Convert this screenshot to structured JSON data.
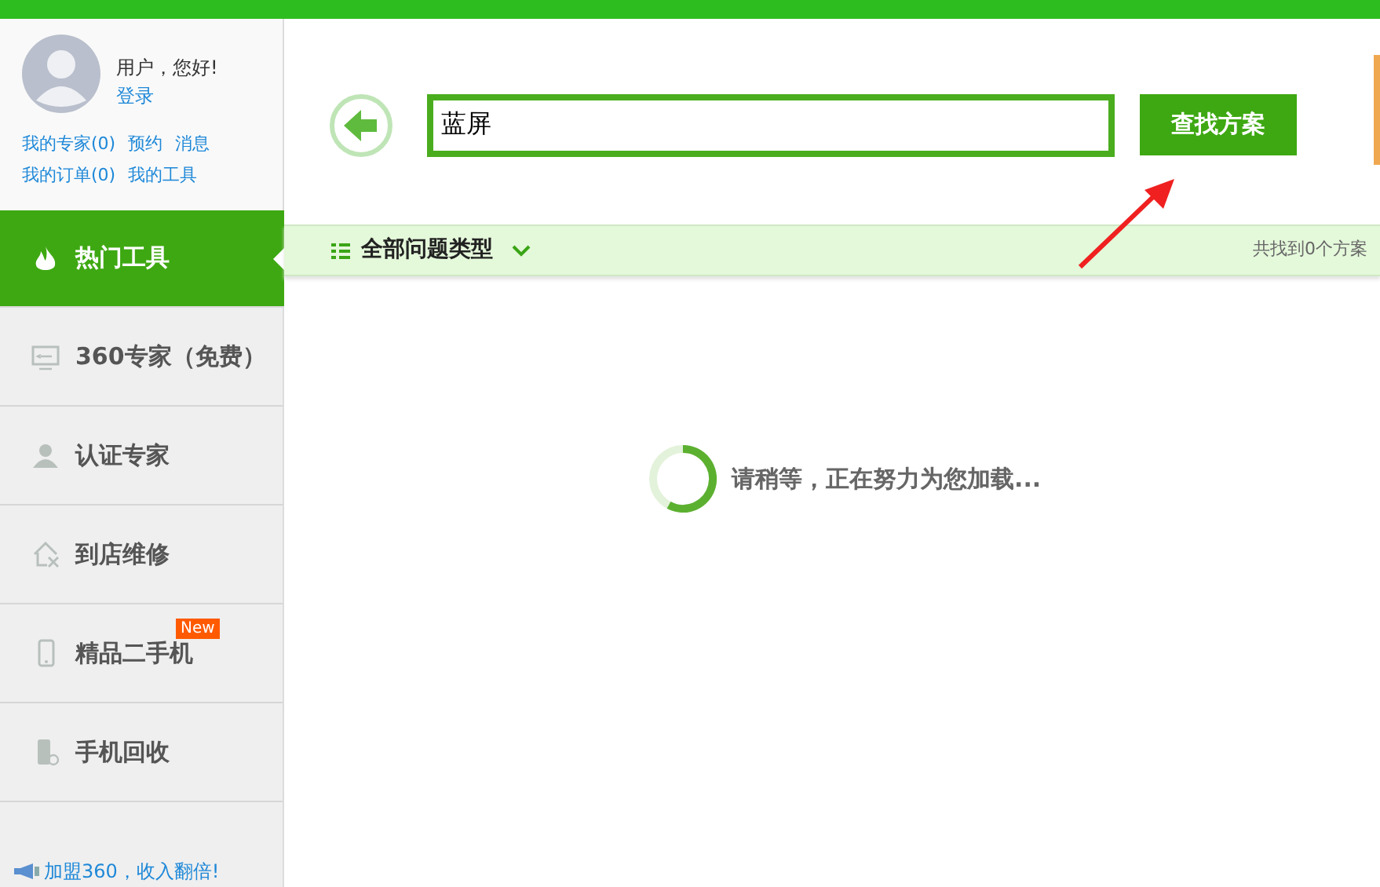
{
  "user": {
    "greeting": "用户，您好!",
    "login": "登录",
    "links": [
      [
        "我的专家(0)",
        "预约",
        "消息"
      ],
      [
        "我的订单(0)",
        "我的工具"
      ]
    ]
  },
  "nav": [
    {
      "label": "热门工具",
      "selected": true
    },
    {
      "label": "360专家（免费）",
      "selected": false
    },
    {
      "label": "认证专家",
      "selected": false
    },
    {
      "label": "到店维修",
      "selected": false
    },
    {
      "label": "精品二手机",
      "selected": false,
      "badge": "New"
    },
    {
      "label": "手机回收",
      "selected": false
    }
  ],
  "promo": "加盟360，收入翻倍!",
  "search": {
    "value": "蓝屏",
    "button": "查找方案"
  },
  "filter": {
    "label": "全部问题类型",
    "count": "共找到0个方案"
  },
  "loading": "请稍等，正在努力为您加载..."
}
